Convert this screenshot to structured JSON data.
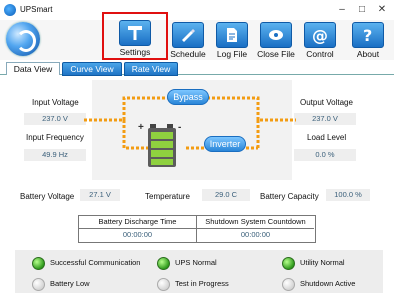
{
  "window": {
    "title": "UPSmart"
  },
  "toolbar": {
    "items": [
      {
        "label": "Settings",
        "icon": "hammer-icon"
      },
      {
        "label": "Schedule",
        "icon": "pencil-icon"
      },
      {
        "label": "Log File",
        "icon": "document-icon"
      },
      {
        "label": "Close File",
        "icon": "disc-icon"
      },
      {
        "label": "Control",
        "icon": "at-icon"
      },
      {
        "label": "About",
        "icon": "question-icon"
      }
    ]
  },
  "tabs": [
    "Data View",
    "Curve View",
    "Rate View"
  ],
  "data": {
    "input_voltage_label": "Input Voltage",
    "input_voltage": "237.0 V",
    "input_frequency_label": "Input Frequency",
    "input_frequency": "49.9 Hz",
    "output_voltage_label": "Output Voltage",
    "output_voltage": "237.0 V",
    "load_level_label": "Load Level",
    "load_level": "0.0 %",
    "bypass_label": "Bypass",
    "inverter_label": "Inverter",
    "battery_plus": "+",
    "battery_minus": "-"
  },
  "stats": {
    "battery_voltage_label": "Battery Voltage",
    "battery_voltage": "27.1 V",
    "temperature_label": "Temperature",
    "temperature": "29.0 C",
    "battery_capacity_label": "Battery Capacity",
    "battery_capacity": "100.0 %"
  },
  "timers": {
    "discharge_label": "Battery Discharge Time",
    "discharge_value": "00:00:00",
    "shutdown_label": "Shutdown System Countdown",
    "shutdown_value": "00:00:00"
  },
  "indicators": [
    {
      "label": "Successful Communication",
      "state": "on"
    },
    {
      "label": "UPS Normal",
      "state": "on"
    },
    {
      "label": "Utility Normal",
      "state": "on"
    },
    {
      "label": "Battery Low",
      "state": "off"
    },
    {
      "label": "Test in Progress",
      "state": "off"
    },
    {
      "label": "Shutdown Active",
      "state": "off"
    }
  ],
  "colors": {
    "accent": "#1a6fc4",
    "led_on": "#2f9a1c",
    "flow": "#f39c12",
    "highlight": "#e01010"
  }
}
